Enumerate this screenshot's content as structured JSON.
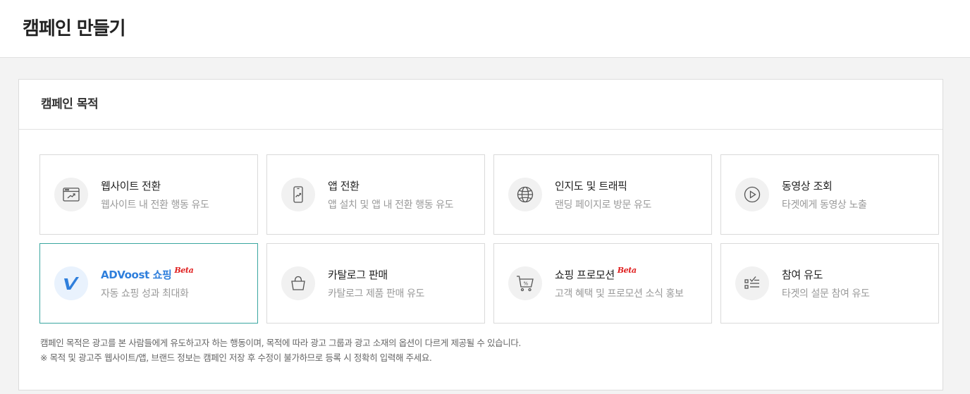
{
  "header": {
    "title": "캠페인 만들기"
  },
  "section": {
    "title": "캠페인 목적"
  },
  "options": [
    {
      "title": "웹사이트 전환",
      "desc": "웹사이트 내 전환 행동 유도",
      "icon": "browser-chart-icon"
    },
    {
      "title": "앱 전환",
      "desc": "앱 설치 및 앱 내 전환 행동 유도",
      "icon": "phone-chart-icon"
    },
    {
      "title": "인지도 및 트래픽",
      "desc": "랜딩 페이지로 방문 유도",
      "icon": "globe-icon"
    },
    {
      "title": "동영상 조회",
      "desc": "타겟에게 동영상 노출",
      "icon": "play-icon"
    },
    {
      "title": "ADVoost 쇼핑",
      "badge": "Beta",
      "desc": "자동 쇼핑 성과 최대화",
      "icon": "advoost-logo-icon",
      "selected": true
    },
    {
      "title": "카탈로그 판매",
      "desc": "카탈로그 제품 판매 유도",
      "icon": "shopping-bag-icon"
    },
    {
      "title": "쇼핑 프로모션",
      "badge": "Beta",
      "desc": "고객 혜택 및 프로모션 소식 홍보",
      "icon": "cart-percent-icon"
    },
    {
      "title": "참여 유도",
      "desc": "타겟의 설문 참여 유도",
      "icon": "survey-checklist-icon"
    }
  ],
  "notes": {
    "line1": "캠페인 목적은 광고를 본 사람들에게 유도하고자 하는 행동이며, 목적에 따라 광고 그룹과 광고 소재의 옵션이 다르게 제공될 수 있습니다.",
    "line2": "※ 목적 및 광고주 웹사이트/앱, 브랜드 정보는 캠페인 저장 후 수정이 불가하므로 등록 시 정확히 입력해 주세요."
  },
  "colors": {
    "selected_border": "#3aa6a0",
    "selected_title": "#2f7fdc",
    "beta_badge": "#e02020"
  }
}
